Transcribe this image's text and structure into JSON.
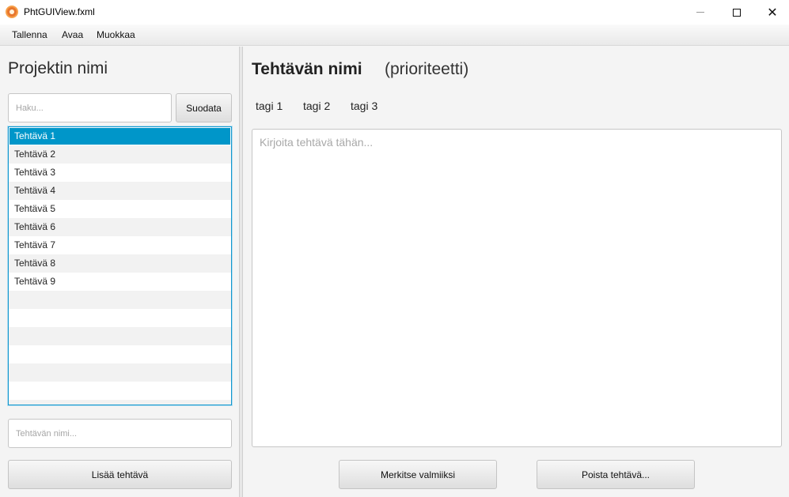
{
  "window": {
    "title": "PhtGUIView.fxml",
    "icon": "app-icon",
    "close_glyph": "✕"
  },
  "menu": {
    "items": [
      "Tallenna",
      "Avaa",
      "Muokkaa"
    ]
  },
  "left": {
    "project_name": "Projektin nimi",
    "search_placeholder": "Haku...",
    "filter_label": "Suodata",
    "tasks": [
      "Tehtävä 1",
      "Tehtävä 2",
      "Tehtävä 3",
      "Tehtävä 4",
      "Tehtävä 5",
      "Tehtävä 6",
      "Tehtävä 7",
      "Tehtävä 8",
      "Tehtävä 9"
    ],
    "selected_task": "Tehtävä 1",
    "task_name_placeholder": "Tehtävän nimi...",
    "add_task_label": "Lisää tehtävä"
  },
  "right": {
    "task_title": "Tehtävän nimi",
    "priority": "(prioriteetti)",
    "tags": [
      "tagi 1",
      "tagi 2",
      "tagi 3"
    ],
    "text_placeholder": "Kirjoita tehtävä tähän...",
    "mark_done_label": "Merkitse valmiiksi",
    "delete_label": "Poista tehtävä..."
  },
  "colors": {
    "selection": "#0096c9",
    "list_border": "#0f96cd"
  }
}
